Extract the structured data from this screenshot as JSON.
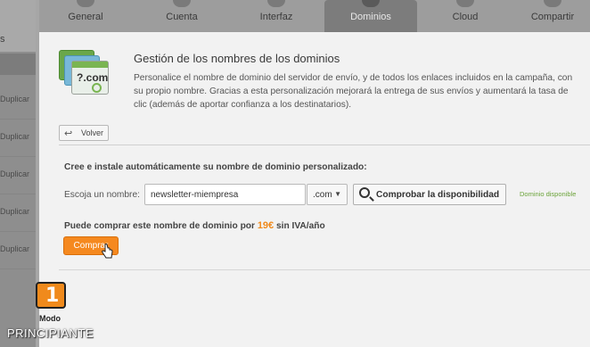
{
  "sidebar": {
    "s_label": "s",
    "rows": [
      "Duplicar",
      "Duplicar",
      "Duplicar",
      "Duplicar",
      "Duplicar",
      "Duplicar"
    ]
  },
  "tabs": [
    {
      "label": "General",
      "active": false
    },
    {
      "label": "Cuenta",
      "active": false
    },
    {
      "label": "Interfaz",
      "active": false
    },
    {
      "label": "Dominios",
      "active": true
    },
    {
      "label": "Cloud",
      "active": false
    },
    {
      "label": "Compartir",
      "active": false
    }
  ],
  "logo": {
    "text": "?.com"
  },
  "header": {
    "title": "Gestión de los nombres de los dominios",
    "description": "Personalice el nombre de dominio del servidor de envío, y de todos los enlaces incluidos en la campaña, con su propio nombre. Gracias a esta personalización mejorará la entrega de sus envíos y aumentará la tasa de clic (además de aportar confianza a los destinatarios)."
  },
  "back_button": {
    "label": "Volver"
  },
  "form": {
    "subtitle": "Cree e instale automáticamente su nombre de dominio personalizado:",
    "name_label": "Escoja un nombre:",
    "name_value": "newsletter-miempresa",
    "tld_value": ".com",
    "check_label": "Comprobar la disponibilidad",
    "availability": "Dominio disponible"
  },
  "purchase": {
    "text_before": "Puede comprar este nombre de dominio por ",
    "price": "19€",
    "text_after": " sin IVA/año",
    "buy_label": "Comprar"
  },
  "brand": {
    "number": "1",
    "modo": "Modo",
    "level": "PRINCIPIANTE"
  },
  "colors": {
    "accent": "#f5891f",
    "success": "#6ba33a"
  }
}
